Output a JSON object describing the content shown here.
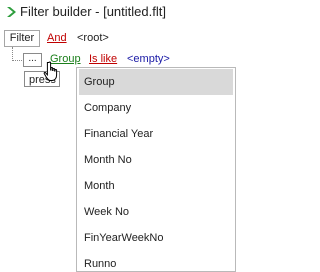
{
  "window": {
    "title": "Filter builder - [untitled.flt]",
    "icon": "chevron-right-icon",
    "accent": "#2e9e3e"
  },
  "tree": {
    "filter_label": "Filter",
    "group_operator": "And",
    "root_label": "<root>",
    "condition": {
      "menu_button": "...",
      "field": "Group",
      "operator": "Is like",
      "value": "<empty>"
    },
    "press_button_label": "press"
  },
  "dropdown": {
    "selected": "Group",
    "items": [
      {
        "label": "Group"
      },
      {
        "label": "Company"
      },
      {
        "label": "Financial Year"
      },
      {
        "label": "Month No"
      },
      {
        "label": "Month"
      },
      {
        "label": "Week No"
      },
      {
        "label": "FinYearWeekNo"
      },
      {
        "label": "Runno"
      }
    ]
  },
  "colors": {
    "operator": "#c00000",
    "field": "#1a7f1a",
    "value": "#1a1aa6",
    "selected_row": "#d9d9d9"
  }
}
